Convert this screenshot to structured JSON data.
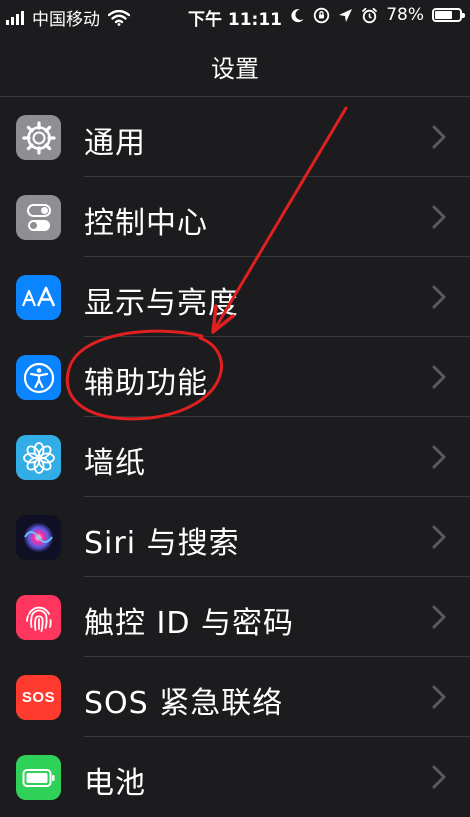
{
  "status_bar": {
    "carrier": "中国移动",
    "time": "下午 11:11",
    "battery": "78%",
    "battery_level": 0.78
  },
  "header": {
    "title": "设置"
  },
  "settings": {
    "items": [
      {
        "label": "通用",
        "icon": "gear-icon",
        "color": "#8e8e93"
      },
      {
        "label": "控制中心",
        "icon": "toggles-icon",
        "color": "#8e8e93"
      },
      {
        "label": "显示与亮度",
        "icon": "text-size-icon",
        "color": "#0a84ff"
      },
      {
        "label": "辅助功能",
        "icon": "accessibility-icon",
        "color": "#0a84ff"
      },
      {
        "label": "墙纸",
        "icon": "flower-icon",
        "color": "#32ade6"
      },
      {
        "label": "Siri 与搜索",
        "icon": "siri-icon",
        "color": "#1c1c3a"
      },
      {
        "label": "触控 ID 与密码",
        "icon": "fingerprint-icon",
        "color": "#ff375f"
      },
      {
        "label": "SOS 紧急联络",
        "icon": "sos-icon",
        "color": "#ff3b30",
        "icon_text": "SOS"
      },
      {
        "label": "电池",
        "icon": "battery-icon",
        "color": "#30d158"
      }
    ]
  },
  "annotation": {
    "color": "#e02020"
  }
}
